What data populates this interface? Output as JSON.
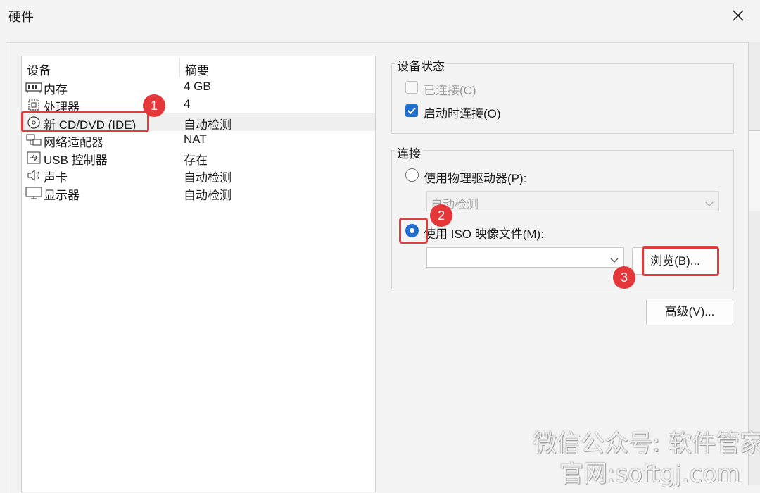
{
  "window": {
    "title": "硬件"
  },
  "device_list": {
    "columns": {
      "device": "设备",
      "summary": "摘要"
    },
    "rows": [
      {
        "name": "内存",
        "summary": "4 GB",
        "icon": "memory-icon"
      },
      {
        "name": "处理器",
        "summary": "4",
        "icon": "processor-icon"
      },
      {
        "name": "新 CD/DVD (IDE)",
        "summary": "自动检测",
        "icon": "cd-dvd-icon",
        "selected": true
      },
      {
        "name": "网络适配器",
        "summary": "NAT",
        "icon": "network-icon"
      },
      {
        "name": "USB 控制器",
        "summary": "存在",
        "icon": "usb-icon"
      },
      {
        "name": "声卡",
        "summary": "自动检测",
        "icon": "speaker-icon"
      },
      {
        "name": "显示器",
        "summary": "自动检测",
        "icon": "monitor-icon"
      }
    ]
  },
  "device_status": {
    "label": "设备状态",
    "connected_label": "已连接(C)",
    "connected_checked": false,
    "connected_disabled": true,
    "connect_on_start_label": "启动时连接(O)",
    "connect_on_start_checked": true
  },
  "connection": {
    "label": "连接",
    "physical_drive_label": "使用物理驱动器(P):",
    "physical_drive_value": "自动检测",
    "iso_label": "使用 ISO 映像文件(M):",
    "iso_value": "",
    "browse_label": "浏览(B)...",
    "selected": "iso"
  },
  "advanced_label": "高级(V)...",
  "annotations": [
    "1",
    "2",
    "3"
  ],
  "watermark": {
    "line1": "微信公众号: 软件管家",
    "line2": "官网:softgj.com"
  },
  "colors": {
    "accent": "#1f6fd1",
    "highlight": "#e03c3c",
    "badge": "#e5363a"
  }
}
